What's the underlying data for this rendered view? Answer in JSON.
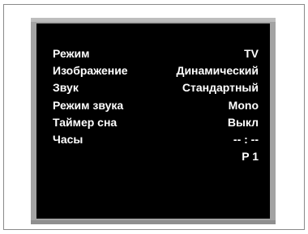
{
  "osd": {
    "rows": [
      {
        "label": "Режим",
        "value": "TV"
      },
      {
        "label": "Изображение",
        "value": "Динамический"
      },
      {
        "label": "Звук",
        "value": "Стандартный"
      },
      {
        "label": "Режим звука",
        "value": "Mono"
      },
      {
        "label": "Таймер сна",
        "value": "Выкл"
      },
      {
        "label": "Часы",
        "value": "-- : --"
      }
    ],
    "channel": "P 1"
  },
  "colors": {
    "screen_background": "#000000",
    "text": "#ffffff",
    "bezel": "#a3a3a3",
    "frame_border": "#8a8a8a"
  }
}
